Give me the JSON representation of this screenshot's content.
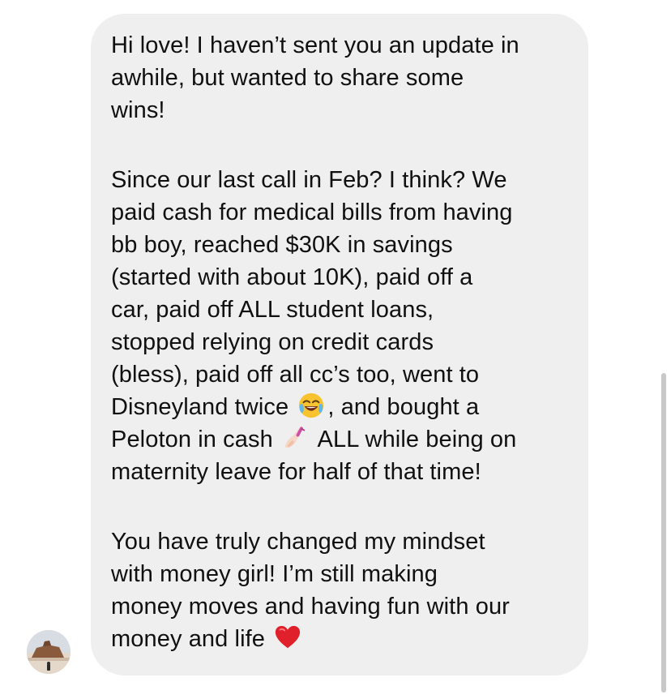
{
  "conversation": {
    "sender": {
      "avatar_icon": "sender-avatar-desert-butte"
    },
    "message": {
      "paragraphs": [
        {
          "lines": [
            "Hi love! I haven’t sent you an update in",
            "awhile, but wanted to share some",
            "wins!"
          ]
        },
        {
          "lines": [
            "Since our last call in Feb? I think? We",
            "paid cash for medical bills from having",
            "bb boy, reached $30K in savings",
            "(started with about 10K), paid off a",
            "car, paid off ALL student loans,",
            "stopped relying on credit cards",
            "(bless), paid off all cc’s too, went to"
          ],
          "disney_line_before": "Disneyland twice",
          "disney_line_after": ", and bought a",
          "peloton_line_before": "Peloton in cash",
          "peloton_line_after": " ALL while being on",
          "last_line": "maternity leave for half of that time!"
        },
        {
          "lines": [
            "You have truly changed my mindset",
            "with money girl! I’m still making",
            "money moves and having fun with our"
          ],
          "last_line_before": "money and life"
        }
      ],
      "emojis": {
        "laugh": "face-with-tears-of-joy-icon",
        "nails": "nail-polish-icon",
        "heart": "red-heart-icon"
      }
    },
    "colors": {
      "bubble": "#efefef",
      "text": "#101010",
      "background": "#ffffff",
      "heart": "#e0202b",
      "emoji_yellow": "#f9c32f"
    }
  }
}
